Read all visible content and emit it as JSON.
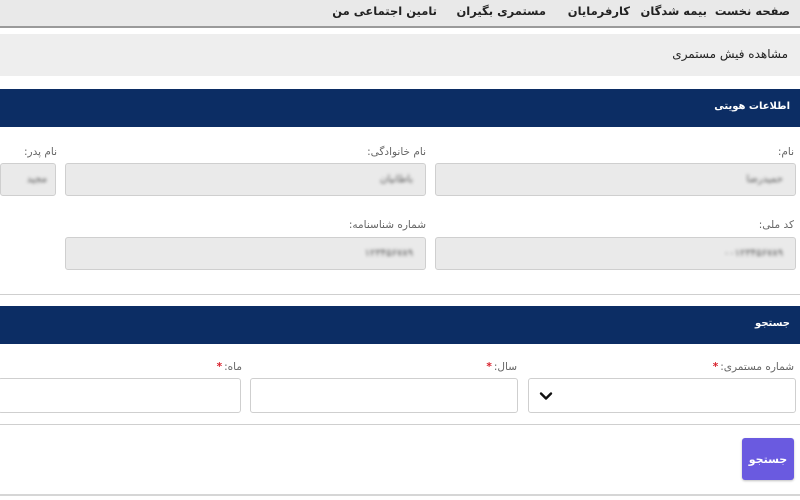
{
  "nav": {
    "items": [
      "صفحه نخست",
      "بیمه شدگان",
      "کارفرمایان",
      "مستمری بگیران",
      "تامین اجتماعی من"
    ]
  },
  "page": {
    "title": "مشاهده فیش مستمری"
  },
  "identity": {
    "header": "اطلاعات هویتی",
    "first_name_label": "نام:",
    "first_name_value": "حمیدرضا",
    "last_name_label": "نام خانوادگی:",
    "last_name_value": "باطانیان",
    "father_name_label": "نام پدر:",
    "father_name_value": "مجید",
    "national_code_label": "کد ملی:",
    "national_code_value": "۰۰۱۲۳۴۵۶۷۸۹",
    "id_number_label": "شماره شناسنامه:",
    "id_number_value": "۱۲۳۴۵۶۷۸۹"
  },
  "search": {
    "header": "جستجو",
    "pension_no_label": "شماره مستمری:",
    "year_label": "سال:",
    "month_label": "ماه:",
    "required_mark": "*",
    "button_label": "جستجو"
  },
  "colors": {
    "section_header": "#0c2d64",
    "button": "#6a5ae0",
    "required": "#d8202b"
  }
}
